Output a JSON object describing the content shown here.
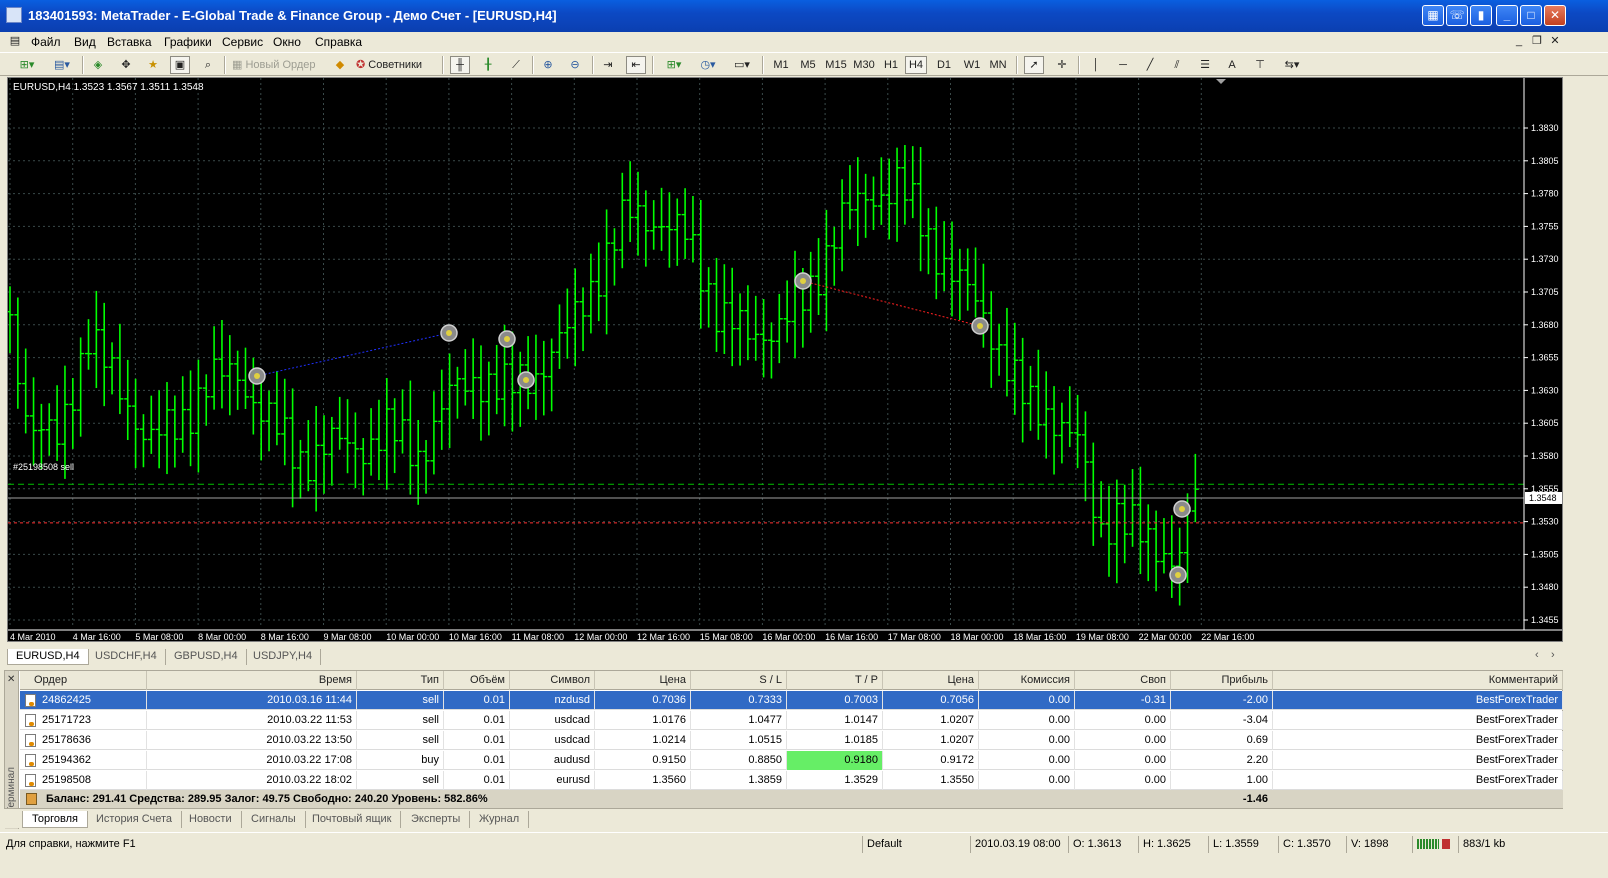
{
  "window": {
    "title": "183401593: MetaTrader - E-Global Trade & Finance Group - Демо Счет - [EURUSD,H4]"
  },
  "menu": [
    "Файл",
    "Вид",
    "Вставка",
    "Графики",
    "Сервис",
    "Окно",
    "Справка"
  ],
  "toolbar": {
    "new_order": "Новый Ордер",
    "experts": "Советники",
    "timeframes": [
      "M1",
      "M5",
      "M15",
      "M30",
      "H1",
      "H4",
      "D1",
      "W1",
      "MN"
    ],
    "active_timeframe": "H4"
  },
  "chart": {
    "header": "EURUSD,H4  1.3523 1.3567 1.3511 1.3548",
    "order_label": "#25198508 sell",
    "current_price": "1.3548",
    "price_labels": [
      "1.3830",
      "1.3805",
      "1.3780",
      "1.3755",
      "1.3730",
      "1.3705",
      "1.3680",
      "1.3655",
      "1.3630",
      "1.3605",
      "1.3580",
      "1.3555",
      "1.3530",
      "1.3505",
      "1.3480",
      "1.3455"
    ],
    "time_labels": [
      "4 Mar 2010",
      "4 Mar 16:00",
      "5 Mar 08:00",
      "8 Mar 00:00",
      "8 Mar 16:00",
      "9 Mar 08:00",
      "10 Mar 00:00",
      "10 Mar 16:00",
      "11 Mar 08:00",
      "12 Mar 00:00",
      "12 Mar 16:00",
      "15 Mar 08:00",
      "16 Mar 00:00",
      "16 Mar 16:00",
      "17 Mar 08:00",
      "18 Mar 00:00",
      "18 Mar 16:00",
      "19 Mar 08:00",
      "22 Mar 00:00",
      "22 Mar 16:00"
    ],
    "colors": {
      "bg": "#000000",
      "bars": "#00ff00",
      "grid": "#3a4a4a",
      "text": "#ffffff"
    }
  },
  "chart_tabs": [
    "EURUSD,H4",
    "USDCHF,H4",
    "GBPUSD,H4",
    "USDJPY,H4"
  ],
  "terminal": {
    "side_label": "Терминал",
    "columns": [
      "Ордер",
      "Время",
      "Тип",
      "Объём",
      "Символ",
      "Цена",
      "S / L",
      "T / P",
      "Цена",
      "Комиссия",
      "Своп",
      "Прибыль",
      "Комментарий"
    ],
    "rows": [
      [
        "24862425",
        "2010.03.16 11:44",
        "sell",
        "0.01",
        "nzdusd",
        "0.7036",
        "0.7333",
        "0.7003",
        "0.7056",
        "0.00",
        "-0.31",
        "-2.00",
        "BestForexTrader"
      ],
      [
        "25171723",
        "2010.03.22 11:53",
        "sell",
        "0.01",
        "usdcad",
        "1.0176",
        "1.0477",
        "1.0147",
        "1.0207",
        "0.00",
        "0.00",
        "-3.04",
        "BestForexTrader"
      ],
      [
        "25178636",
        "2010.03.22 13:50",
        "sell",
        "0.01",
        "usdcad",
        "1.0214",
        "1.0515",
        "1.0185",
        "1.0207",
        "0.00",
        "0.00",
        "0.69",
        "BestForexTrader"
      ],
      [
        "25194362",
        "2010.03.22 17:08",
        "buy",
        "0.01",
        "audusd",
        "0.9150",
        "0.8850",
        "0.9180",
        "0.9172",
        "0.00",
        "0.00",
        "2.20",
        "BestForexTrader"
      ],
      [
        "25198508",
        "2010.03.22 18:02",
        "sell",
        "0.01",
        "eurusd",
        "1.3560",
        "1.3859",
        "1.3529",
        "1.3550",
        "0.00",
        "0.00",
        "1.00",
        "BestForexTrader"
      ]
    ],
    "summary": "Баланс: 291.41  Средства: 289.95  Залог: 49.75  Свободно: 240.20  Уровень: 582.86%",
    "summary_total": "-1.46",
    "tabs": [
      "Торговля",
      "История Счета",
      "Новости",
      "Сигналы",
      "Почтовый ящик",
      "Эксперты",
      "Журнал"
    ]
  },
  "status": {
    "help": "Для справки, нажмите F1",
    "profile": "Default",
    "datetime": "2010.03.19 08:00",
    "open": "O: 1.3613",
    "high": "H: 1.3625",
    "low": "L: 1.3559",
    "close": "C: 1.3570",
    "volume": "V: 1898",
    "traffic": "883/1 kb"
  }
}
